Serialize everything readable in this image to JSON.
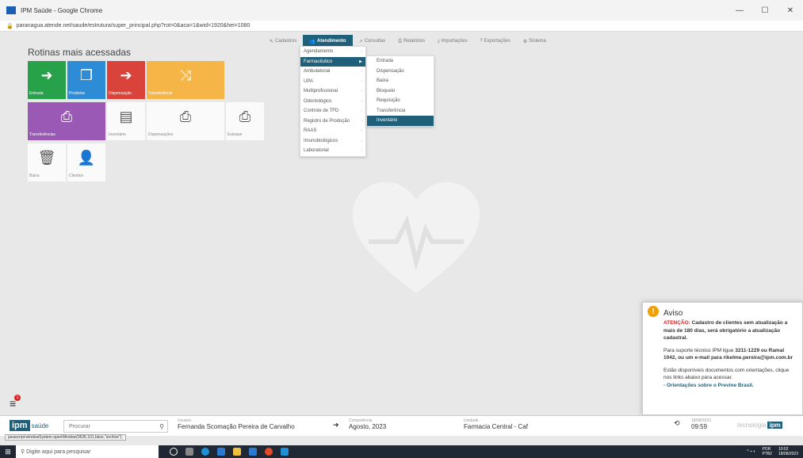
{
  "window": {
    "title": "IPM Saúde - Google Chrome",
    "url": "paranagua.atende.net/saude/estrutura/super_principal.php?rot=0&aca=1&wid=1920&hei=1080"
  },
  "nav": [
    {
      "label": "Cadastros"
    },
    {
      "label": "Atendimento"
    },
    {
      "label": "Consultas"
    },
    {
      "label": "Relatórios"
    },
    {
      "label": "Importações"
    },
    {
      "label": "Exportações"
    },
    {
      "label": "Sistema"
    }
  ],
  "section_title": "Rotinas mais acessadas",
  "tiles": [
    {
      "label": "Entrada"
    },
    {
      "label": "Produtos"
    },
    {
      "label": "Dispensação"
    },
    {
      "label": "Transferência"
    },
    {
      "label": "Transferências"
    },
    {
      "label": "Inventário"
    },
    {
      "label": "Dispensações"
    },
    {
      "label": "Estoque"
    },
    {
      "label": "Baixa"
    },
    {
      "label": "Clientes"
    }
  ],
  "menu_atendimento": [
    {
      "label": "Agendamento"
    },
    {
      "label": "Farmacêutico"
    },
    {
      "label": "Ambulatorial"
    },
    {
      "label": "UPA"
    },
    {
      "label": "Multiprofissional"
    },
    {
      "label": "Odontológico"
    },
    {
      "label": "Controle de TFD"
    },
    {
      "label": "Registro de Produção"
    },
    {
      "label": "RAAS"
    },
    {
      "label": "Imunobiológicos"
    },
    {
      "label": "Laboratorial"
    }
  ],
  "menu_farmaceutico": [
    {
      "label": "Entrada"
    },
    {
      "label": "Dispensação"
    },
    {
      "label": "Baixa"
    },
    {
      "label": "Bloqueio"
    },
    {
      "label": "Requisição"
    },
    {
      "label": "Transferência"
    },
    {
      "label": "Inventário"
    }
  ],
  "notifications_count": "1",
  "aviso": {
    "title": "Aviso",
    "attention": "ATENÇÃO:",
    "attention_text": "Cadastro de clientes sem atualização a mais de 180 dias, será obrigatório a atualização cadastral.",
    "support_text": "Para suporte técnico IPM ligue",
    "support_phone": "3211-1229 ou Ramal 1042, ou um e-mail para",
    "support_email": "rikelme.pereira@ipm.com.br",
    "docs_text": "Estão disponíveis documentos com orientações, clique nos links abaixo para acessar.",
    "link": "- Orientações sobre o Previne Brasil."
  },
  "footer": {
    "logo_ipm": "ipm",
    "logo_saude": "saúde",
    "search_placeholder": "Procurar",
    "usuario_label": "Usuário",
    "usuario": "Fernanda Scomação Pereira de Carvalho",
    "competencia_label": "Competência",
    "competencia": "Agosto, 2023",
    "unidade_label": "Unidade",
    "unidade": "Farmacia Central - Caf",
    "date": "18/08/2023",
    "time": "09:59",
    "tecnologia": "tecnologia",
    "tecnologia_brand": "ipm"
  },
  "status_tip": "javascript:windowSystem.openWindow(9636,101,false,\"archive\");",
  "taskbar": {
    "search_placeholder": "Digite aqui para pesquisar",
    "lang": "POR",
    "lang_sub": "PTB2",
    "time": "10:02",
    "date": "18/08/2023"
  }
}
